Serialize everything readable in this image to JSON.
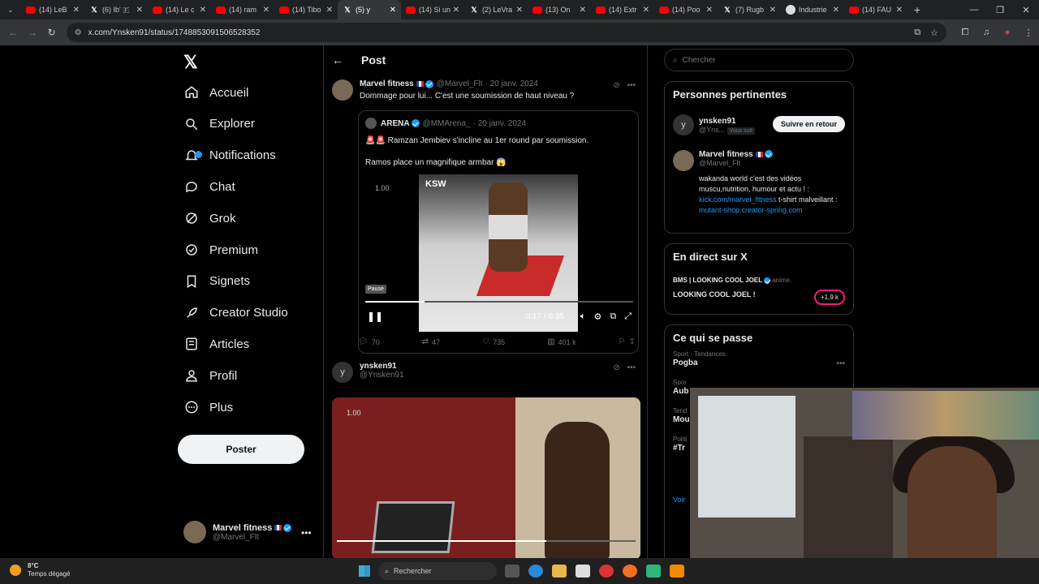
{
  "browser": {
    "tabs": [
      {
        "title": "(14) LeB",
        "icon": "youtube"
      },
      {
        "title": "(6) Ib' 🇫",
        "icon": "x"
      },
      {
        "title": "(14) Le c",
        "icon": "youtube"
      },
      {
        "title": "(14) ram",
        "icon": "youtube"
      },
      {
        "title": "(14) Tibo",
        "icon": "youtube"
      },
      {
        "title": "(5) y",
        "icon": "x",
        "active": true
      },
      {
        "title": "(14) Si un",
        "icon": "youtube"
      },
      {
        "title": "(2) LeVra",
        "icon": "x"
      },
      {
        "title": "(13) On",
        "icon": "youtube"
      },
      {
        "title": "(14) Extr",
        "icon": "youtube"
      },
      {
        "title": "(14) Poo",
        "icon": "youtube"
      },
      {
        "title": "(7) Rugb",
        "icon": "x"
      },
      {
        "title": "Industrie",
        "icon": "globe"
      },
      {
        "title": "(14) FAU",
        "icon": "youtube"
      }
    ],
    "url": "x.com/Ynsken91/status/1748853091506528352"
  },
  "sidebar": {
    "items": [
      {
        "label": "Accueil",
        "icon": "home-icon"
      },
      {
        "label": "Explorer",
        "icon": "search-icon"
      },
      {
        "label": "Notifications",
        "icon": "bell-icon"
      },
      {
        "label": "Chat",
        "icon": "chat-icon"
      },
      {
        "label": "Grok",
        "icon": "grok-icon"
      },
      {
        "label": "Premium",
        "icon": "premium-icon"
      },
      {
        "label": "Signets",
        "icon": "bookmark-icon"
      },
      {
        "label": "Creator Studio",
        "icon": "rocket-icon"
      },
      {
        "label": "Articles",
        "icon": "article-icon"
      },
      {
        "label": "Profil",
        "icon": "person-icon"
      },
      {
        "label": "Plus",
        "icon": "more-icon"
      }
    ],
    "post_button": "Poster",
    "account": {
      "name": "Marvel fitness",
      "handle": "@Marvel_Flt"
    }
  },
  "main": {
    "header": "Post",
    "tweet1": {
      "name": "Marvel fitness",
      "handle": "@Marvel_Flt",
      "date": "· 20 janv. 2024",
      "text": "Dommage pour lui... C'est une soumission de haut niveau ?",
      "quote": {
        "name": "ARENA",
        "handle": "@MMArena_",
        "date": "· 20 janv. 2024",
        "line1": "🚨🚨 Ramzan Jembiev s'incline au 1er round par soumission.",
        "line2": "Ramos place un magnifique armbar 😱",
        "video": {
          "speed": "1.00",
          "tooltip": "Pause",
          "time": "0:17 / 0:35",
          "progress": 0.22,
          "brand": "KSW"
        }
      },
      "stats": {
        "replies": "70",
        "reposts": "47",
        "likes": "735",
        "views": "401 k"
      }
    },
    "tweet2": {
      "name": "ynsken91",
      "handle": "@Ynsken91",
      "avatar_letter": "y",
      "video": {
        "speed": "1.00",
        "progress": 0.7
      }
    }
  },
  "right": {
    "search_placeholder": "Chercher",
    "relevant": {
      "title": "Personnes pertinentes",
      "person1": {
        "name": "ynsken91",
        "handle": "@Yns...",
        "badge": "Vous suit",
        "button": "Suivre en retour",
        "avatar_letter": "y"
      },
      "person2": {
        "name": "Marvel fitness",
        "handle": "@Marvel_Flt",
        "bio1": "wakanda world c'est des vidéos muscu,nutrition, humour et actu ! :",
        "link1": "kick.com/marvel_fitness",
        "bio2": " t-shirt malveillant : ",
        "link2": "mutant-shop.creator-spring.com"
      }
    },
    "live": {
      "title": "En direct sur X",
      "host": "BMS | LOOKING COOL JOEL",
      "suffix": "anime.",
      "show": "LOOKING COOL JOEL !",
      "count": "+1,9 k"
    },
    "trending": {
      "title": "Ce qui se passe",
      "items": [
        {
          "category": "Sport · Tendances",
          "title": "Pogba"
        },
        {
          "category": "Spor",
          "title": "Aub"
        },
        {
          "category": "Tend",
          "title": "Mou"
        },
        {
          "category": "Politi",
          "title": "#Tr"
        }
      ],
      "more": "Voir"
    }
  },
  "taskbar": {
    "temp": "8°C",
    "weather": "Temps dégagé",
    "search": "Rechercher"
  }
}
